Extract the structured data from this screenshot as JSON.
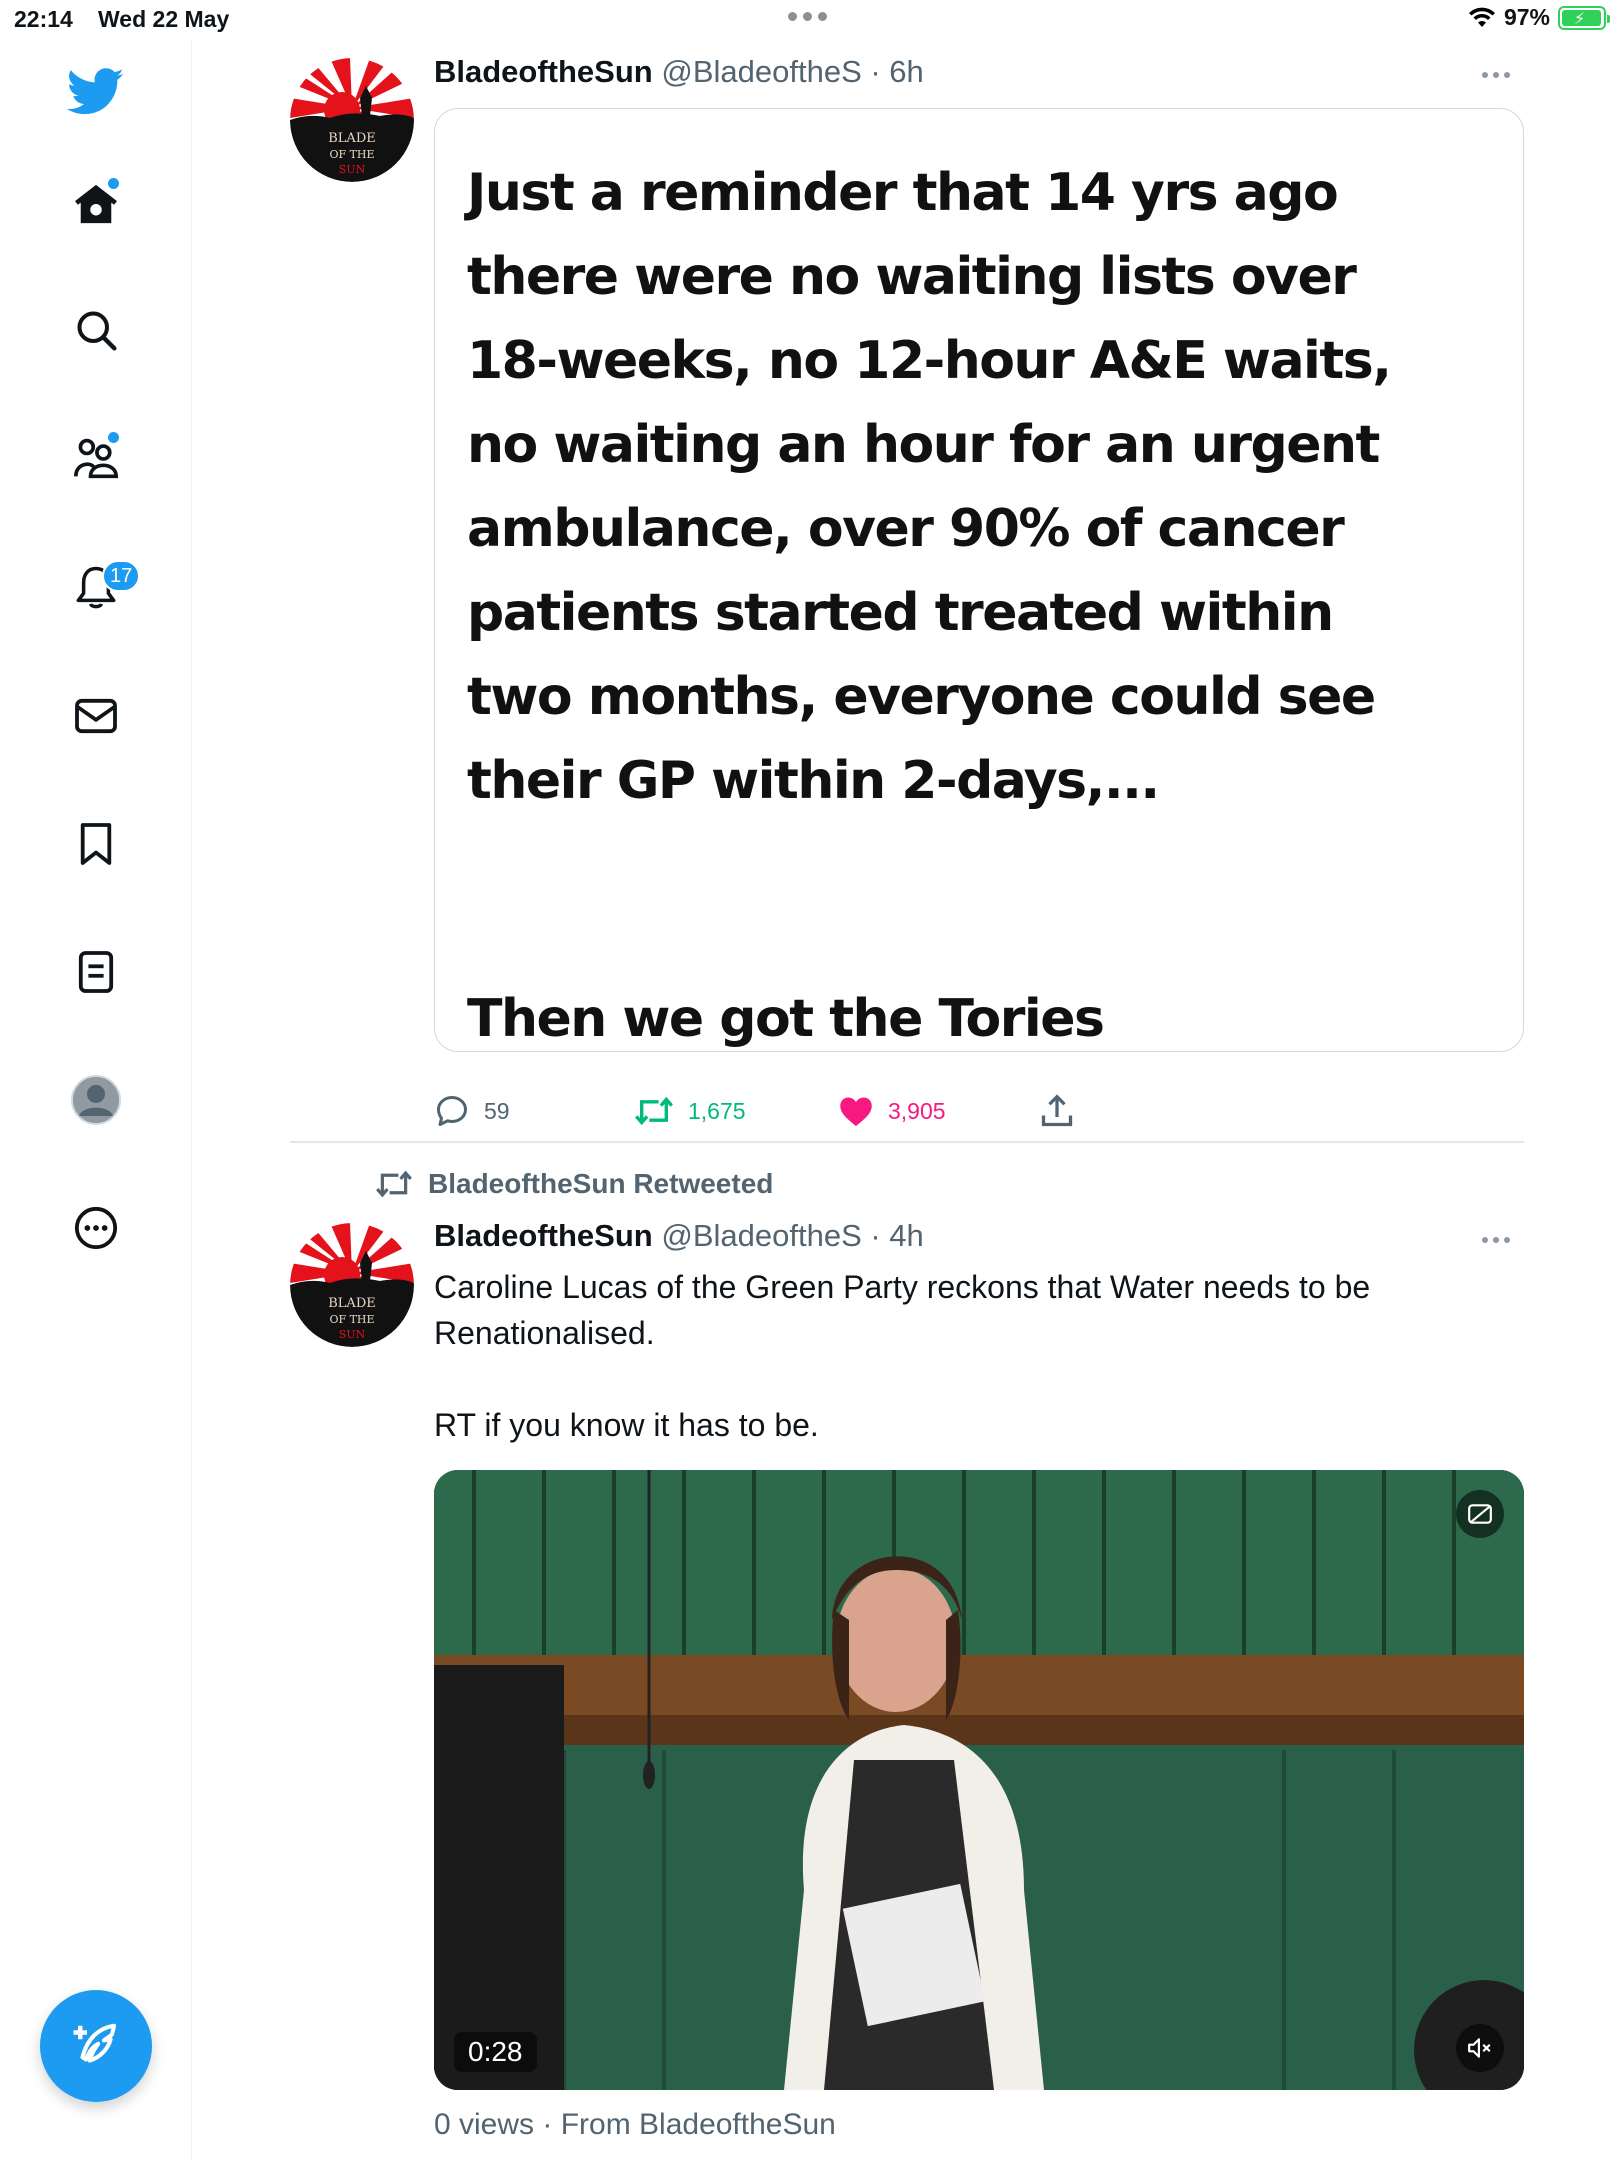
{
  "status_bar": {
    "time": "22:14",
    "date": "Wed 22 May",
    "battery": "97%",
    "battery_level": 0.97
  },
  "sidebar": {
    "notifications_count": "17",
    "items": [
      "home",
      "explore",
      "communities",
      "notifications",
      "messages",
      "bookmarks",
      "lists",
      "profile",
      "more"
    ]
  },
  "colors": {
    "accent": "#1d9bf0",
    "retweet": "#00ba7c",
    "like": "#f91880",
    "muted": "#536471"
  },
  "tweets": [
    {
      "name": "BladeoftheSun",
      "handle": "@BladeoftheS",
      "time": "· 6h",
      "avatar_text": "BLADE OF THE SUN",
      "image_text": "Just a reminder that 14 yrs ago\nthere were no waiting lists over\n18-weeks, no 12-hour A&E waits,\nno waiting an hour for an urgent\nambulance, over 90% of cancer\npatients started treated within\ntwo months, everyone could see\ntheir GP within 2-days,...",
      "image_text_end": "Then we got the Tories",
      "replies": "59",
      "retweets": "1,675",
      "likes": "3,905"
    },
    {
      "retweeted_by": "BladeoftheSun Retweeted",
      "name": "BladeoftheSun",
      "handle": "@BladeoftheS",
      "time": "· 4h",
      "text": "Caroline Lucas of the Green Party reckons that Water needs to be\nRenationalised.\n\nRT if you know it has to be.",
      "video_duration": "0:28",
      "views": "0 views · From BladeoftheSun"
    }
  ]
}
